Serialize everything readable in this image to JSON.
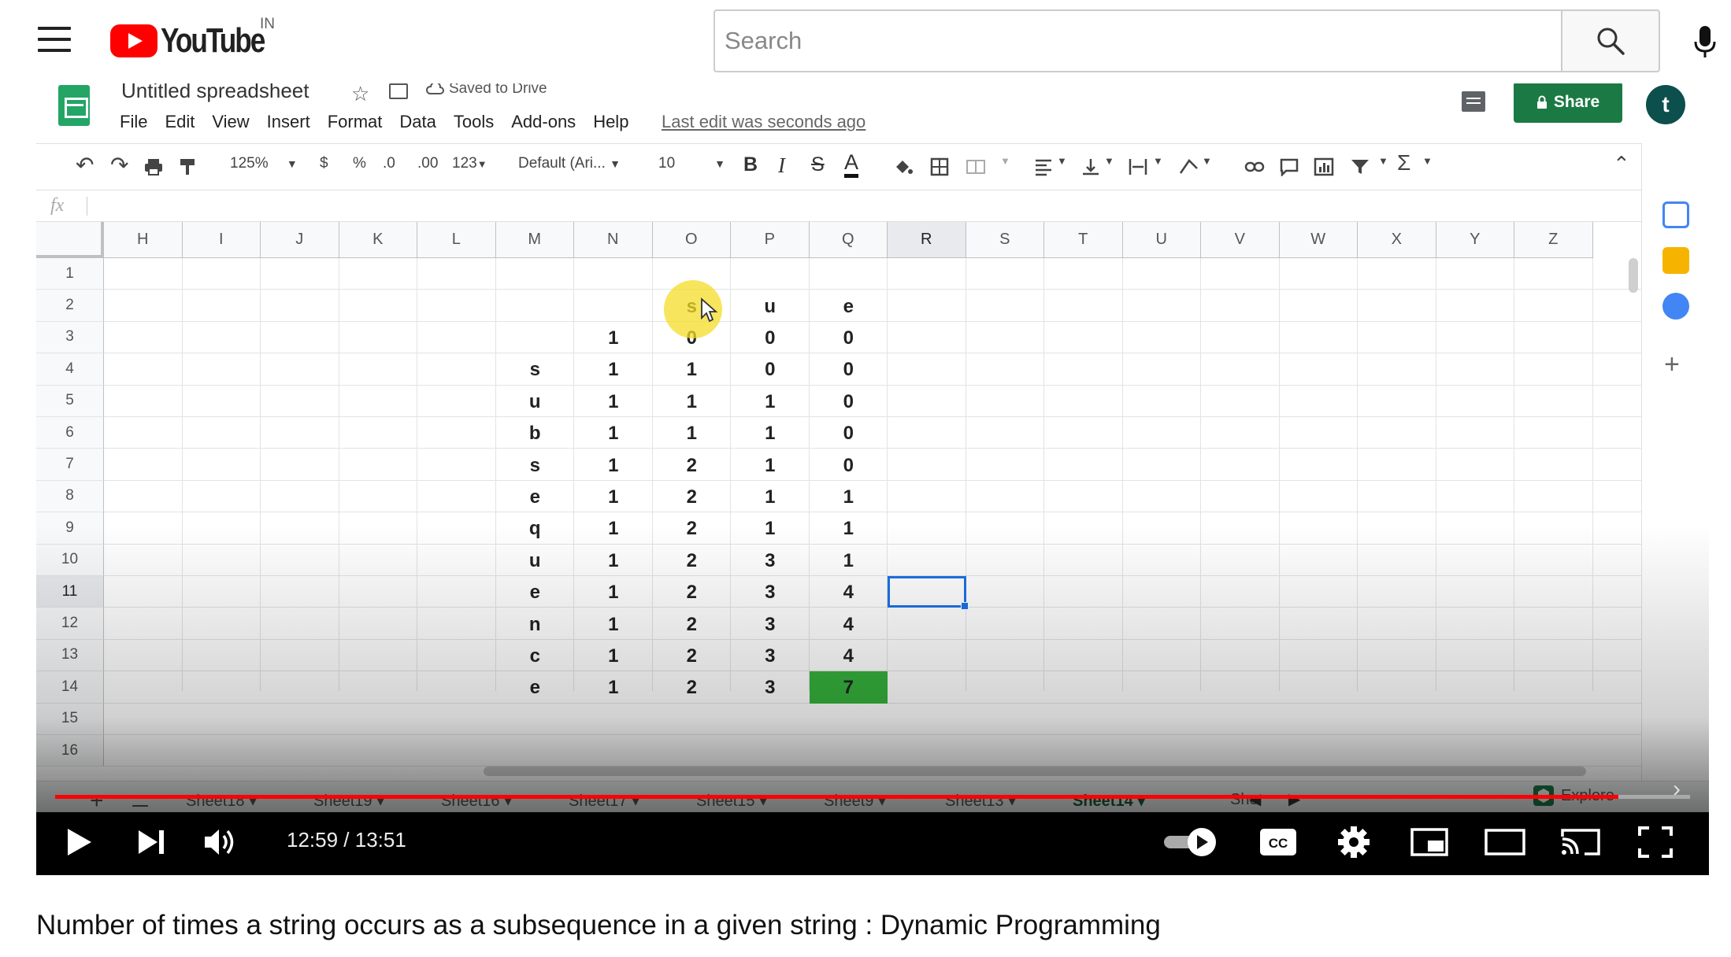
{
  "masthead": {
    "logo_text": "YouTube",
    "country_code": "IN",
    "search_placeholder": "Search"
  },
  "sheets": {
    "doc_title": "Untitled spreadsheet",
    "saved_status": "Saved to Drive",
    "menu": [
      "File",
      "Edit",
      "View",
      "Insert",
      "Format",
      "Data",
      "Tools",
      "Add-ons",
      "Help"
    ],
    "last_edit": "Last edit was seconds ago",
    "share_label": "Share",
    "account_initial": "t",
    "toolbar": {
      "zoom": "125%",
      "currency": "$",
      "percent": "%",
      "decrease_decimal": ".0",
      "increase_decimal": ".00",
      "more_formats": "123",
      "font": "Default (Ari...",
      "font_size": "10",
      "bold": "B",
      "italic": "I",
      "strike": "S",
      "text_color": "A"
    },
    "formula_label": "fx",
    "columns": [
      "H",
      "I",
      "J",
      "K",
      "L",
      "M",
      "N",
      "O",
      "P",
      "Q",
      "R",
      "S",
      "T",
      "U",
      "V",
      "W",
      "X",
      "Y",
      "Z"
    ],
    "selected_column": "R",
    "rows": [
      "1",
      "2",
      "3",
      "4",
      "5",
      "6",
      "7",
      "8",
      "9",
      "10",
      "11",
      "12",
      "13",
      "14",
      "15",
      "16"
    ],
    "selected_row": "11",
    "table": {
      "header_row_2": {
        "O": "s",
        "P": "u",
        "Q": "e"
      },
      "row_3": {
        "N": "1",
        "O": "0",
        "P": "0",
        "Q": "0"
      },
      "row_labels": [
        "s",
        "u",
        "b",
        "s",
        "e",
        "q",
        "u",
        "e",
        "n",
        "c",
        "e"
      ],
      "col_N": [
        "1",
        "1",
        "1",
        "1",
        "1",
        "1",
        "1",
        "1",
        "1",
        "1",
        "1"
      ],
      "col_O": [
        "1",
        "1",
        "1",
        "2",
        "2",
        "2",
        "2",
        "2",
        "2",
        "2",
        "2"
      ],
      "col_P": [
        "0",
        "1",
        "1",
        "1",
        "1",
        "1",
        "3",
        "3",
        "3",
        "3",
        "3"
      ],
      "col_Q": [
        "0",
        "0",
        "0",
        "0",
        "1",
        "1",
        "1",
        "4",
        "4",
        "4",
        "7"
      ]
    },
    "highlight_color": "#35b23c",
    "sheet_tabs": [
      "Sheet18",
      "Sheet19",
      "Sheet16",
      "Sheet17",
      "Sheet15",
      "Sheet9",
      "Sheet13",
      "Sheet14",
      "She"
    ],
    "active_tab": "Sheet14",
    "explore_label": "Explore"
  },
  "player": {
    "time_display": "12:59 / 13:51",
    "progress_fraction": 0.956,
    "accent_color": "#ff0000"
  },
  "video": {
    "title": "Number of times a string occurs as a subsequence in a given string : Dynamic Programming"
  }
}
